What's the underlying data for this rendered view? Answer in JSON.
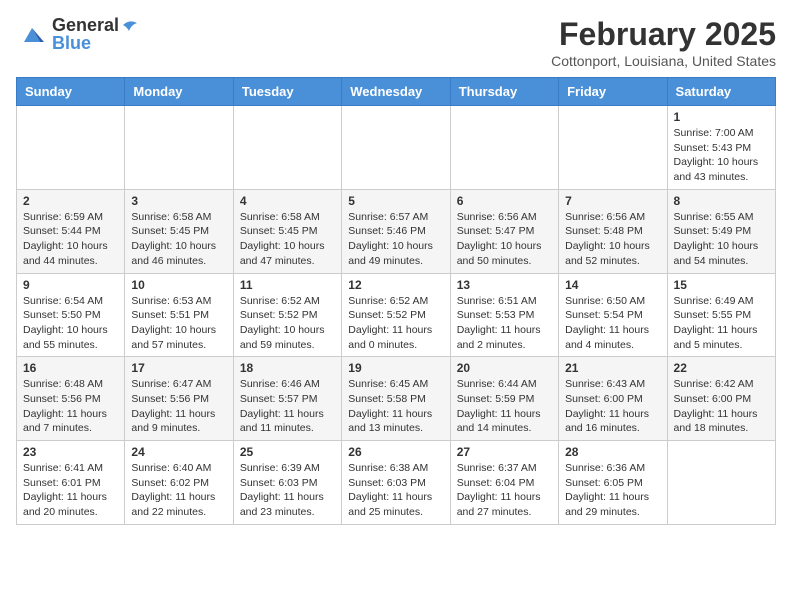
{
  "header": {
    "logo_general": "General",
    "logo_blue": "Blue",
    "month_title": "February 2025",
    "location": "Cottonport, Louisiana, United States"
  },
  "weekdays": [
    "Sunday",
    "Monday",
    "Tuesday",
    "Wednesday",
    "Thursday",
    "Friday",
    "Saturday"
  ],
  "weeks": [
    [
      {
        "num": "",
        "info": ""
      },
      {
        "num": "",
        "info": ""
      },
      {
        "num": "",
        "info": ""
      },
      {
        "num": "",
        "info": ""
      },
      {
        "num": "",
        "info": ""
      },
      {
        "num": "",
        "info": ""
      },
      {
        "num": "1",
        "info": "Sunrise: 7:00 AM\nSunset: 5:43 PM\nDaylight: 10 hours and 43 minutes."
      }
    ],
    [
      {
        "num": "2",
        "info": "Sunrise: 6:59 AM\nSunset: 5:44 PM\nDaylight: 10 hours and 44 minutes."
      },
      {
        "num": "3",
        "info": "Sunrise: 6:58 AM\nSunset: 5:45 PM\nDaylight: 10 hours and 46 minutes."
      },
      {
        "num": "4",
        "info": "Sunrise: 6:58 AM\nSunset: 5:45 PM\nDaylight: 10 hours and 47 minutes."
      },
      {
        "num": "5",
        "info": "Sunrise: 6:57 AM\nSunset: 5:46 PM\nDaylight: 10 hours and 49 minutes."
      },
      {
        "num": "6",
        "info": "Sunrise: 6:56 AM\nSunset: 5:47 PM\nDaylight: 10 hours and 50 minutes."
      },
      {
        "num": "7",
        "info": "Sunrise: 6:56 AM\nSunset: 5:48 PM\nDaylight: 10 hours and 52 minutes."
      },
      {
        "num": "8",
        "info": "Sunrise: 6:55 AM\nSunset: 5:49 PM\nDaylight: 10 hours and 54 minutes."
      }
    ],
    [
      {
        "num": "9",
        "info": "Sunrise: 6:54 AM\nSunset: 5:50 PM\nDaylight: 10 hours and 55 minutes."
      },
      {
        "num": "10",
        "info": "Sunrise: 6:53 AM\nSunset: 5:51 PM\nDaylight: 10 hours and 57 minutes."
      },
      {
        "num": "11",
        "info": "Sunrise: 6:52 AM\nSunset: 5:52 PM\nDaylight: 10 hours and 59 minutes."
      },
      {
        "num": "12",
        "info": "Sunrise: 6:52 AM\nSunset: 5:52 PM\nDaylight: 11 hours and 0 minutes."
      },
      {
        "num": "13",
        "info": "Sunrise: 6:51 AM\nSunset: 5:53 PM\nDaylight: 11 hours and 2 minutes."
      },
      {
        "num": "14",
        "info": "Sunrise: 6:50 AM\nSunset: 5:54 PM\nDaylight: 11 hours and 4 minutes."
      },
      {
        "num": "15",
        "info": "Sunrise: 6:49 AM\nSunset: 5:55 PM\nDaylight: 11 hours and 5 minutes."
      }
    ],
    [
      {
        "num": "16",
        "info": "Sunrise: 6:48 AM\nSunset: 5:56 PM\nDaylight: 11 hours and 7 minutes."
      },
      {
        "num": "17",
        "info": "Sunrise: 6:47 AM\nSunset: 5:56 PM\nDaylight: 11 hours and 9 minutes."
      },
      {
        "num": "18",
        "info": "Sunrise: 6:46 AM\nSunset: 5:57 PM\nDaylight: 11 hours and 11 minutes."
      },
      {
        "num": "19",
        "info": "Sunrise: 6:45 AM\nSunset: 5:58 PM\nDaylight: 11 hours and 13 minutes."
      },
      {
        "num": "20",
        "info": "Sunrise: 6:44 AM\nSunset: 5:59 PM\nDaylight: 11 hours and 14 minutes."
      },
      {
        "num": "21",
        "info": "Sunrise: 6:43 AM\nSunset: 6:00 PM\nDaylight: 11 hours and 16 minutes."
      },
      {
        "num": "22",
        "info": "Sunrise: 6:42 AM\nSunset: 6:00 PM\nDaylight: 11 hours and 18 minutes."
      }
    ],
    [
      {
        "num": "23",
        "info": "Sunrise: 6:41 AM\nSunset: 6:01 PM\nDaylight: 11 hours and 20 minutes."
      },
      {
        "num": "24",
        "info": "Sunrise: 6:40 AM\nSunset: 6:02 PM\nDaylight: 11 hours and 22 minutes."
      },
      {
        "num": "25",
        "info": "Sunrise: 6:39 AM\nSunset: 6:03 PM\nDaylight: 11 hours and 23 minutes."
      },
      {
        "num": "26",
        "info": "Sunrise: 6:38 AM\nSunset: 6:03 PM\nDaylight: 11 hours and 25 minutes."
      },
      {
        "num": "27",
        "info": "Sunrise: 6:37 AM\nSunset: 6:04 PM\nDaylight: 11 hours and 27 minutes."
      },
      {
        "num": "28",
        "info": "Sunrise: 6:36 AM\nSunset: 6:05 PM\nDaylight: 11 hours and 29 minutes."
      },
      {
        "num": "",
        "info": ""
      }
    ]
  ]
}
